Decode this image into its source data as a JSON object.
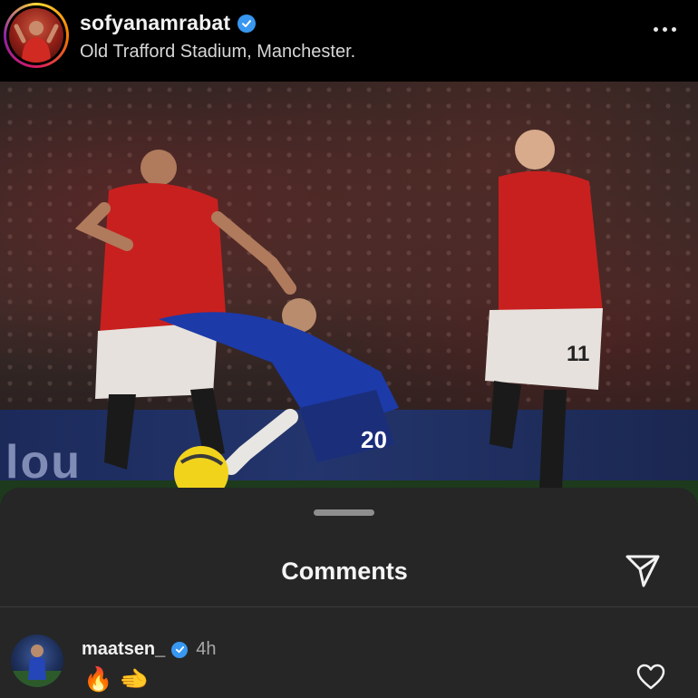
{
  "post": {
    "username": "sofyanamrabat",
    "location": "Old Trafford Stadium, Manchester.",
    "avatar_icon": "profile-avatar",
    "verified_icon": "verified-badge-icon",
    "more_icon": "more-options-icon"
  },
  "photo": {
    "alt": "football-match-photo",
    "ad_board_text": "lou"
  },
  "comments_sheet": {
    "title": "Comments",
    "share_icon": "send-icon",
    "comments": [
      {
        "username": "maatsen_",
        "time": "4h",
        "text": "🔥 🫲",
        "like_icon": "heart-outline-icon"
      }
    ]
  },
  "colors": {
    "background": "#000000",
    "sheet": "#262626",
    "verified": "#3897f0",
    "muted_text": "#a8a8a8"
  }
}
